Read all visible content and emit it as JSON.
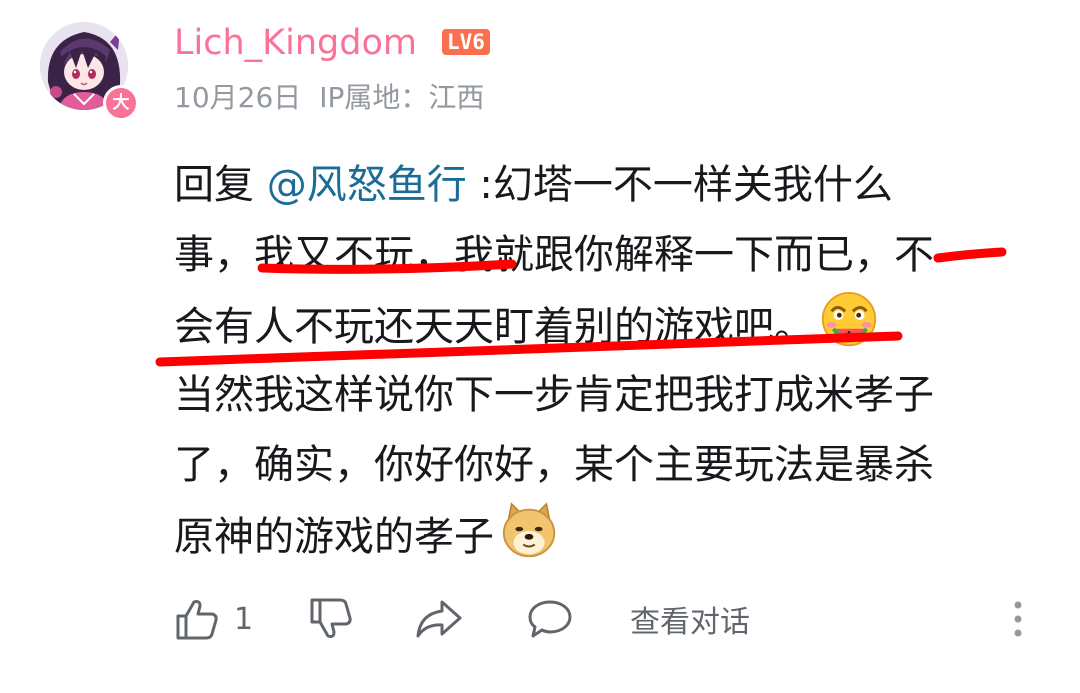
{
  "user": {
    "name": "Lich_Kingdom",
    "level": "LV6",
    "badge": "大",
    "date": "10月26日",
    "ip": "IP属地：江西"
  },
  "comment": {
    "lines": [
      {
        "prefix": "回复 ",
        "mention": "@风怒鱼行",
        "text": " :幻塔一不一样关我什么"
      },
      {
        "text": "事，我又不玩，我就跟你解释一下而已，不"
      },
      {
        "text": "会有人不玩还天天盯着别的游戏吧。"
      },
      {
        "text": "当然我这样说你下一步肯定把我打成米孝子"
      },
      {
        "text": "了，确实，你好你好，某个主要玩法是暴杀"
      },
      {
        "text": "原神的游戏的孝子"
      }
    ],
    "emojis": [
      "eating-watermelon-emoji",
      "doge-emoji"
    ]
  },
  "actions": {
    "like_count": "1",
    "view_dialog": "查看对话",
    "icons": [
      "thumbs-up-icon",
      "thumbs-down-icon",
      "share-icon",
      "reply-icon",
      "more-icon"
    ]
  },
  "colors": {
    "username": "#fb7299",
    "level_badge": "#fb6e4e",
    "mention": "#1b6c97",
    "meta": "#9499a0",
    "annotation": "#ff0000"
  }
}
